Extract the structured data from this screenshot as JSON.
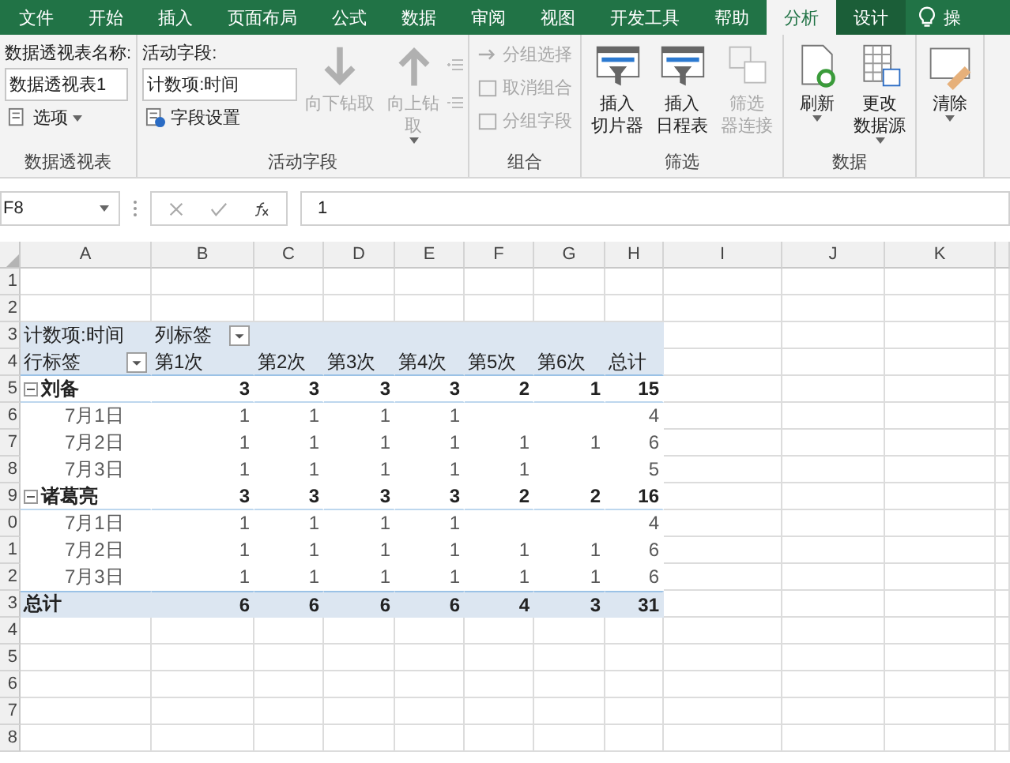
{
  "tabs": [
    {
      "label": "文件",
      "kind": "file",
      "selected": false
    },
    {
      "label": "开始",
      "kind": "normal",
      "selected": false
    },
    {
      "label": "插入",
      "kind": "normal",
      "selected": false
    },
    {
      "label": "页面布局",
      "kind": "normal",
      "selected": false
    },
    {
      "label": "公式",
      "kind": "normal",
      "selected": false
    },
    {
      "label": "数据",
      "kind": "normal",
      "selected": false
    },
    {
      "label": "审阅",
      "kind": "normal",
      "selected": false
    },
    {
      "label": "视图",
      "kind": "normal",
      "selected": false
    },
    {
      "label": "开发工具",
      "kind": "normal",
      "selected": false
    },
    {
      "label": "帮助",
      "kind": "normal",
      "selected": false
    },
    {
      "label": "分析",
      "kind": "context",
      "selected": true
    },
    {
      "label": "设计",
      "kind": "context",
      "selected": false
    },
    {
      "label": "操",
      "kind": "tell",
      "selected": false
    }
  ],
  "ribbon": [
    {
      "label": "数据透视表",
      "kind": "name",
      "field_label": "数据透视表名称:",
      "field_value": "数据透视表1",
      "button": "选项"
    },
    {
      "label": "活动字段",
      "kind": "field",
      "field_label": "活动字段:",
      "field_value": "计数项:时间",
      "button": "字段设置",
      "large": [
        {
          "lines": [
            "向下钻取"
          ],
          "disabled": true,
          "menu": false
        },
        {
          "lines": [
            "向上钻",
            "取"
          ],
          "disabled": true,
          "menu": true
        }
      ]
    },
    {
      "label": "组合",
      "kind": "small",
      "small": [
        {
          "label": "分组选择",
          "disabled": true
        },
        {
          "label": "取消组合",
          "disabled": true
        },
        {
          "label": "分组字段",
          "disabled": true
        }
      ]
    },
    {
      "label": "筛选",
      "kind": "large",
      "large": [
        {
          "lines": [
            "插入",
            "切片器"
          ],
          "disabled": false,
          "menu": false
        },
        {
          "lines": [
            "插入",
            "日程表"
          ],
          "disabled": false,
          "menu": false
        },
        {
          "lines": [
            "筛选",
            "器连接"
          ],
          "disabled": true,
          "menu": false
        }
      ]
    },
    {
      "label": "数据",
      "kind": "large",
      "large": [
        {
          "lines": [
            "刷新"
          ],
          "disabled": false,
          "menu": true
        },
        {
          "lines": [
            "更改",
            "数据源"
          ],
          "disabled": false,
          "menu": true
        }
      ]
    },
    {
      "kind": "large",
      "large": [
        {
          "lines": [
            "清除"
          ],
          "disabled": false,
          "menu": true
        }
      ]
    }
  ],
  "formula_bar": {
    "name_box": "F8",
    "formula": "1"
  },
  "sheet": {
    "columns": [
      "A",
      "B",
      "C",
      "D",
      "E",
      "F",
      "G",
      "H",
      "I",
      "J",
      "K"
    ],
    "rows": [
      {
        "number": "1",
        "kind": "empty"
      },
      {
        "number": "2",
        "kind": "empty"
      },
      {
        "number": "3",
        "kind": "filter",
        "cells": [
          "计数项:时间",
          "列标签"
        ]
      },
      {
        "number": "4",
        "kind": "header",
        "cells": [
          "行标签",
          "第1次",
          "第2次",
          "第3次",
          "第4次",
          "第5次",
          "第6次",
          "总计"
        ]
      },
      {
        "number": "5",
        "kind": "group",
        "expanded": true,
        "cells": [
          "刘备",
          "3",
          "3",
          "3",
          "3",
          "2",
          "1",
          "15"
        ]
      },
      {
        "number": "6",
        "kind": "item",
        "cells": [
          "7月1日",
          "1",
          "1",
          "1",
          "1",
          "",
          "",
          "4"
        ]
      },
      {
        "number": "7",
        "kind": "item",
        "cells": [
          "7月2日",
          "1",
          "1",
          "1",
          "1",
          "1",
          "1",
          "6"
        ]
      },
      {
        "number": "8",
        "kind": "item",
        "cells": [
          "7月3日",
          "1",
          "1",
          "1",
          "1",
          "1",
          "",
          "5"
        ]
      },
      {
        "number": "9",
        "kind": "group",
        "expanded": true,
        "cells": [
          "诸葛亮",
          "3",
          "3",
          "3",
          "3",
          "2",
          "2",
          "16"
        ]
      },
      {
        "number": "0",
        "kind": "item",
        "cells": [
          "7月1日",
          "1",
          "1",
          "1",
          "1",
          "",
          "",
          "4"
        ]
      },
      {
        "number": "1",
        "kind": "item",
        "cells": [
          "7月2日",
          "1",
          "1",
          "1",
          "1",
          "1",
          "1",
          "6"
        ]
      },
      {
        "number": "2",
        "kind": "item",
        "cells": [
          "7月3日",
          "1",
          "1",
          "1",
          "1",
          "1",
          "1",
          "6"
        ]
      },
      {
        "number": "3",
        "kind": "total",
        "cells": [
          "总计",
          "6",
          "6",
          "6",
          "6",
          "4",
          "3",
          "31"
        ]
      },
      {
        "number": "4",
        "kind": "empty"
      },
      {
        "number": "5",
        "kind": "empty"
      },
      {
        "number": "6",
        "kind": "empty"
      },
      {
        "number": "7",
        "kind": "empty"
      },
      {
        "number": "8",
        "kind": "empty"
      }
    ]
  }
}
